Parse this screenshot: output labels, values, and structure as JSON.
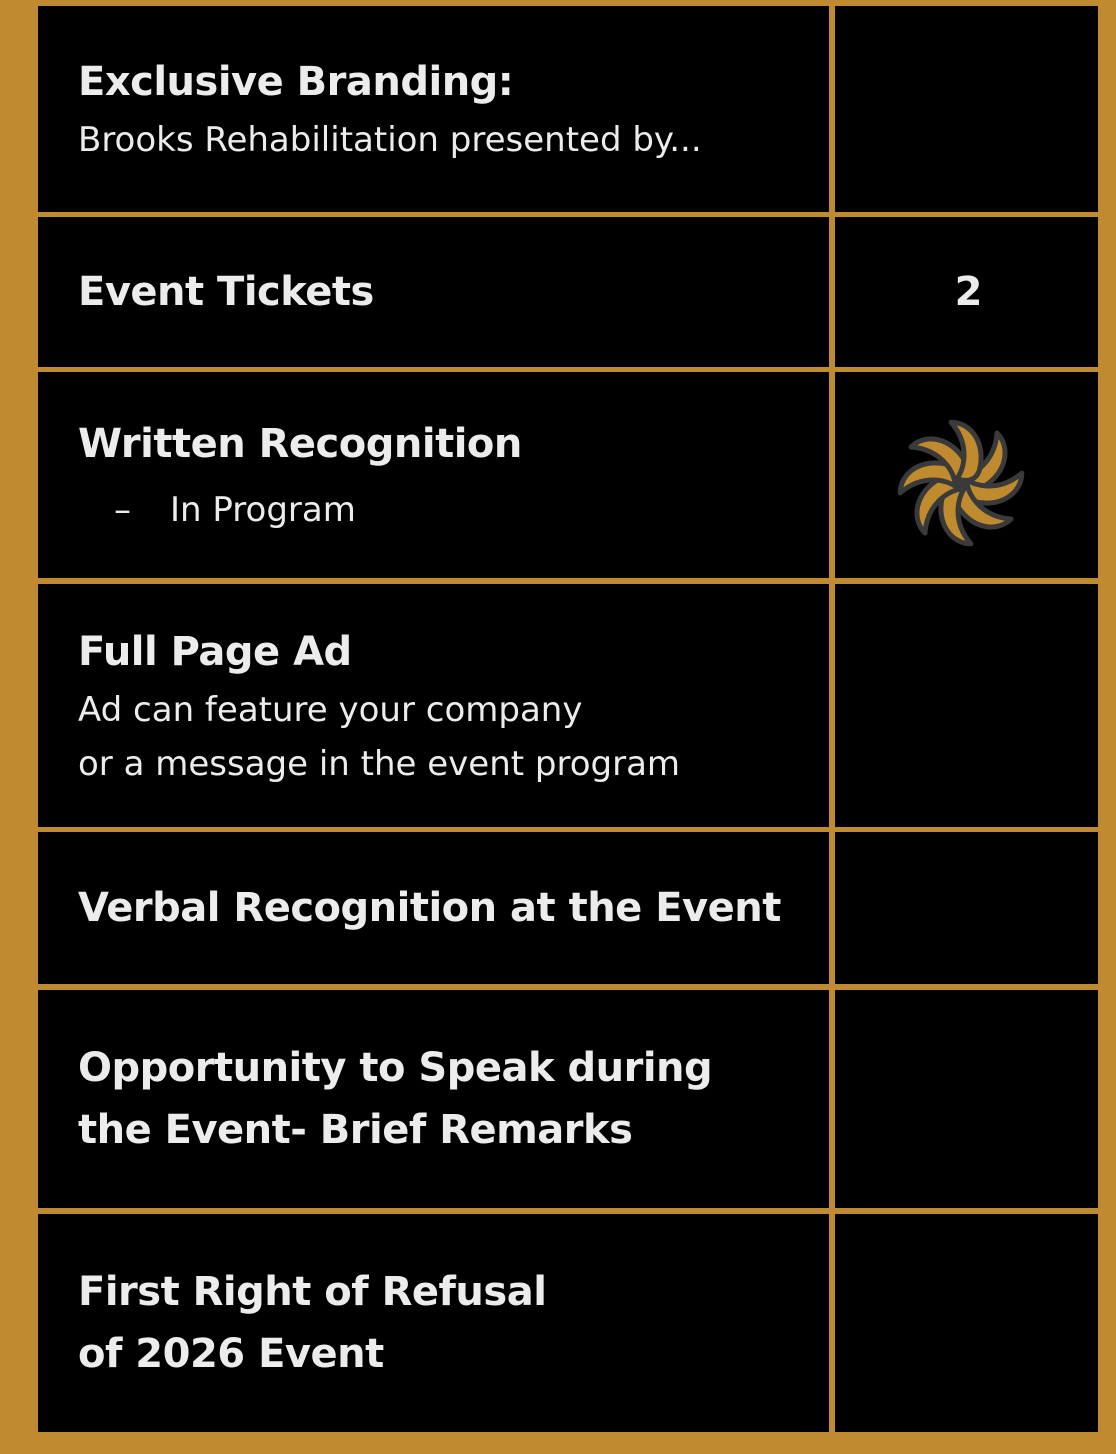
{
  "rows": [
    {
      "title": "Exclusive Branding:",
      "lines": [
        "Brooks Rehabilitation presented by..."
      ],
      "value": ""
    },
    {
      "title": "Event Tickets",
      "lines": [],
      "value": "2"
    },
    {
      "title": "Written Recognition",
      "bullet": "–",
      "bullet_text": "In Program",
      "value_icon": "swirl-check-icon"
    },
    {
      "title": "Full Page Ad",
      "lines": [
        "Ad can feature your company",
        "or a message in the event program"
      ],
      "value": ""
    },
    {
      "title": "Verbal Recognition at the Event",
      "lines": [],
      "value": ""
    },
    {
      "title_lines": [
        "Opportunity to Speak during",
        "the Event- Brief Remarks"
      ],
      "value": ""
    },
    {
      "title_lines": [
        "First Right of Refusal",
        "of 2026 Event"
      ],
      "value": ""
    }
  ],
  "colors": {
    "border": "#BF8A30",
    "cell": "#000000",
    "text": "#ECECEC",
    "icon_fill": "#C08B2F",
    "icon_stroke": "#3A3A3A"
  }
}
